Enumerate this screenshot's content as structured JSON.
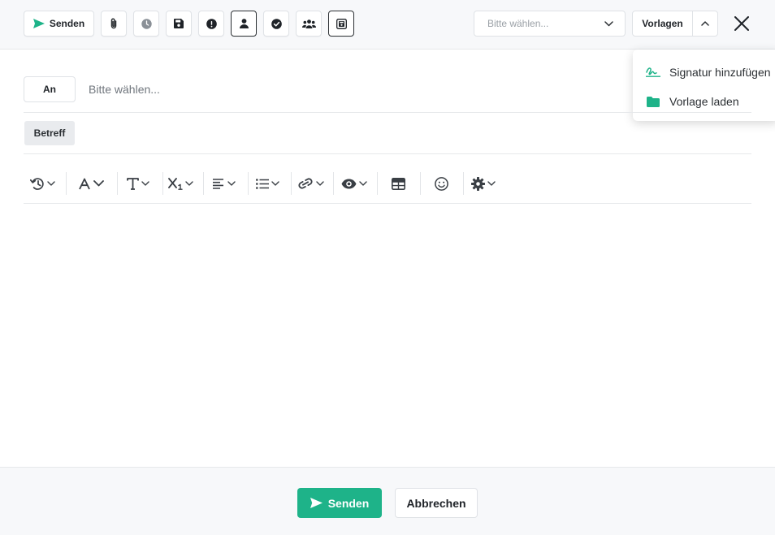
{
  "toolbar": {
    "send_label": "Senden",
    "icons": [
      "paperclip-icon",
      "clock-icon",
      "save-icon",
      "exclamation-icon",
      "user-icon",
      "check-circle-icon",
      "users-icon",
      "save-copy-icon"
    ]
  },
  "select": {
    "placeholder": "Bitte wählen..."
  },
  "templates": {
    "label": "Vorlagen"
  },
  "dropdown": {
    "items": [
      {
        "label": "Signatur hinzufügen",
        "icon": "signature-icon"
      },
      {
        "label": "Vorlage laden",
        "icon": "folder-icon"
      }
    ]
  },
  "recipients": {
    "label": "An",
    "placeholder": "Bitte wählen..."
  },
  "subject": {
    "label": "Betreff"
  },
  "editor_toolbar": [
    "history-icon",
    "font-color-icon",
    "text-style-icon",
    "subscript-icon",
    "align-left-icon",
    "list-icon",
    "link-icon",
    "preview-icon",
    "table-icon",
    "emoji-icon",
    "settings-icon"
  ],
  "footer": {
    "send_label": "Senden",
    "cancel_label": "Abbrechen"
  },
  "colors": {
    "accent": "#1eb389",
    "text": "#1f2328",
    "muted": "#70767d"
  }
}
